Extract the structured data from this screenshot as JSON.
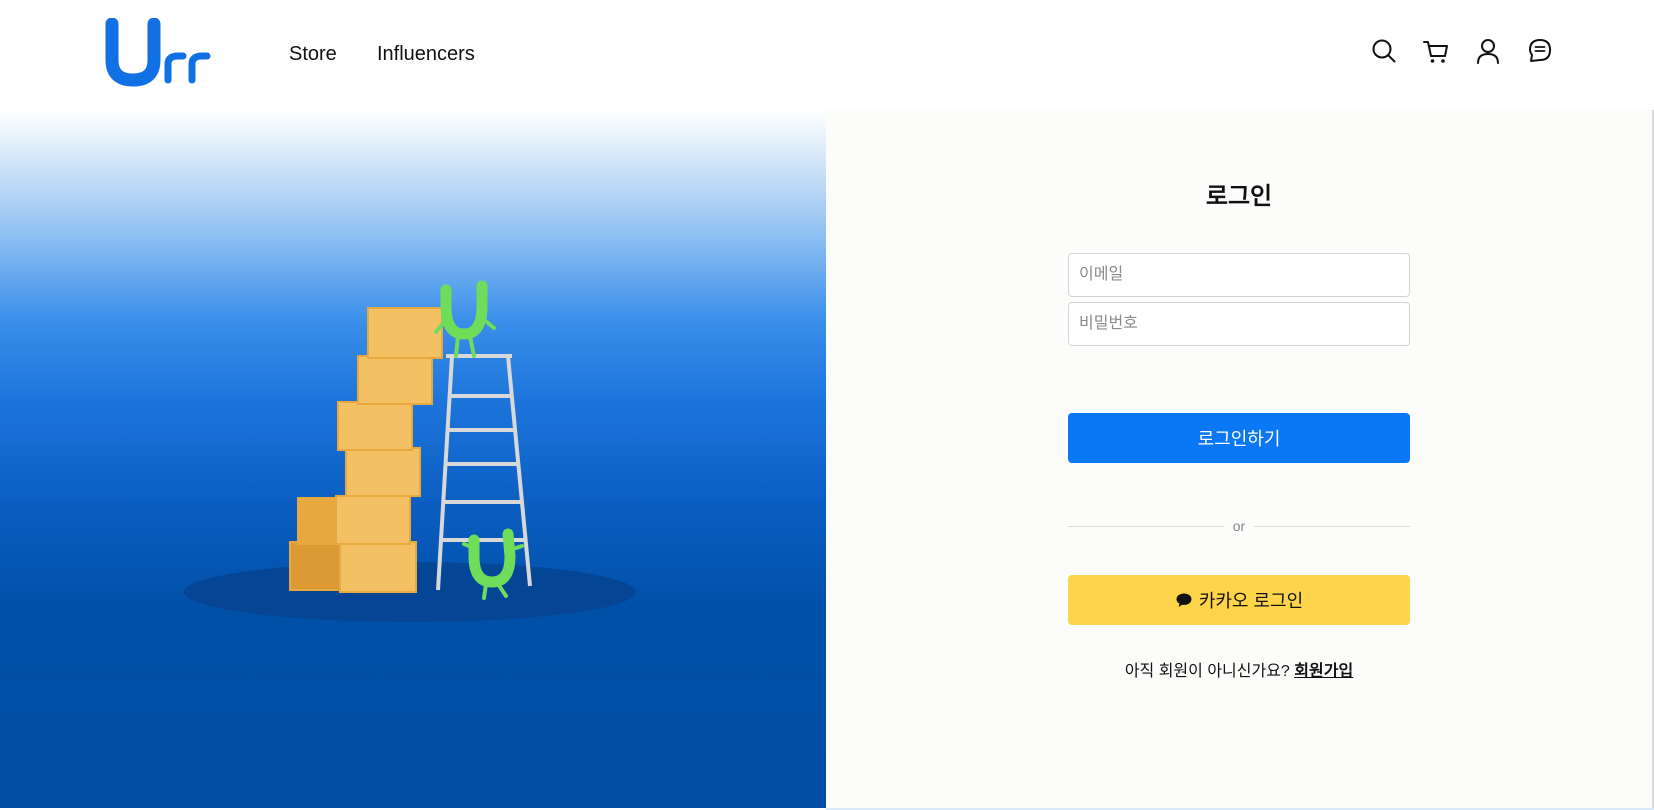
{
  "header": {
    "logo_text": "Urr",
    "nav": [
      {
        "label": "Store"
      },
      {
        "label": "Influencers"
      }
    ],
    "icons": [
      "search-icon",
      "cart-icon",
      "user-icon",
      "chat-icon"
    ]
  },
  "login": {
    "title": "로그인",
    "email_placeholder": "이메일",
    "password_placeholder": "비밀번호",
    "submit_label": "로그인하기",
    "divider_text": "or",
    "kakao_label": "카카오 로그인",
    "signup_prompt": "아직 회원이 아니신가요?",
    "signup_link": "회원가입"
  },
  "colors": {
    "brand_blue": "#0a78f5",
    "logo_blue": "#1170e4",
    "kakao_yellow": "#fed54a",
    "mascot_green": "#6fdc5a",
    "box_orange": "#f3c063"
  }
}
